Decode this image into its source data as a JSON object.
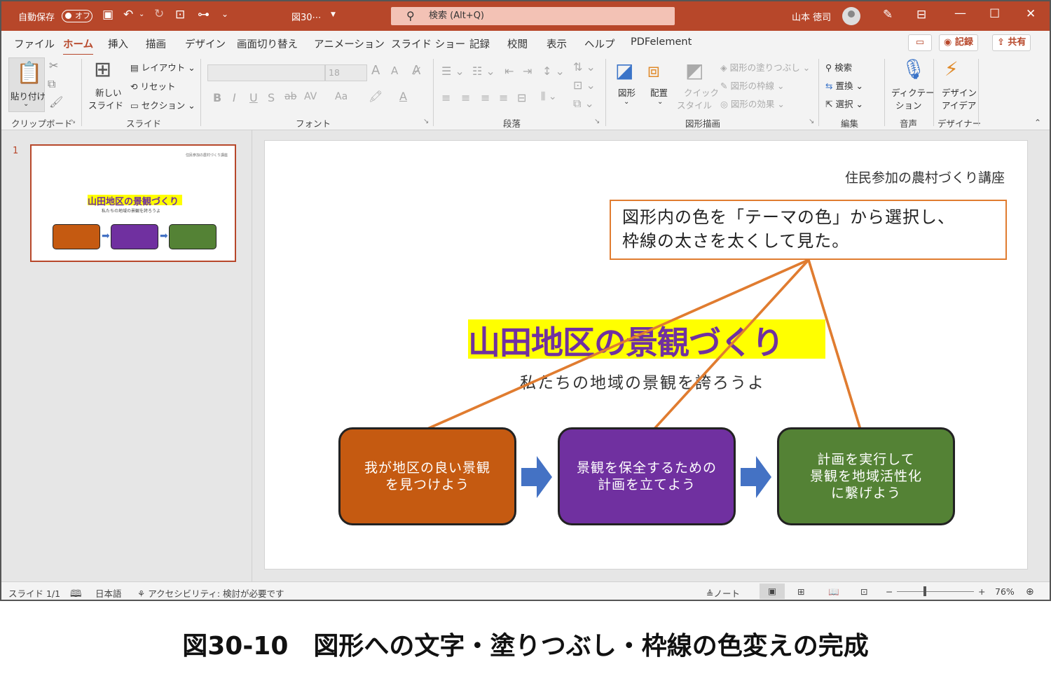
{
  "titlebar": {
    "autosave_label": "自動保存",
    "autosave_state": "オフ",
    "filename": "図30⋯",
    "search_placeholder": "検索 (Alt+Q)",
    "user_name": "山本 徳司"
  },
  "menu": {
    "tabs": [
      "ファイル",
      "ホーム",
      "挿入",
      "描画",
      "デザイン",
      "画面切り替え",
      "アニメーション",
      "スライド ショー",
      "記録",
      "校閲",
      "表示",
      "ヘルプ",
      "PDFelement"
    ],
    "active_tab": "ホーム",
    "record_button": "記録",
    "share_button": "共有"
  },
  "ribbon": {
    "clipboard": {
      "paste": "貼り付け",
      "group": "クリップボード"
    },
    "slides": {
      "new_slide_1": "新しい",
      "new_slide_2": "スライド",
      "layout": "レイアウト",
      "reset": "リセット",
      "section": "セクション",
      "group": "スライド"
    },
    "font": {
      "size": "18",
      "group": "フォント",
      "bold": "B",
      "italic": "I",
      "underline": "U",
      "shadow": "S",
      "strike": "ab",
      "spacing": "AV",
      "case": "Aa",
      "grow": "A",
      "shrink": "A"
    },
    "paragraph": {
      "group": "段落"
    },
    "drawing": {
      "shapes": "図形",
      "arrange": "配置",
      "quick1": "クイック",
      "quick2": "スタイル",
      "fill": "図形の塗りつぶし",
      "outline": "図形の枠線",
      "effects": "図形の効果",
      "group": "図形描画"
    },
    "editing": {
      "find": "検索",
      "replace": "置換",
      "select": "選択",
      "group": "編集"
    },
    "voice": {
      "dictate1": "ディクテー",
      "dictate2": "ション",
      "group": "音声"
    },
    "designer": {
      "idea1": "デザイン",
      "idea2": "アイデア",
      "group": "デザイナー"
    }
  },
  "thumbnail": {
    "number": "1"
  },
  "slide": {
    "header": "住民参加の農村づくり講座",
    "callout_line1": "図形内の色を「テーマの色」から選択し、",
    "callout_line2": "枠線の太さを太くして見た。",
    "title": "山田地区の景観づくり",
    "subtitle": "私たちの地域の景観を誇ろうよ",
    "boxes": [
      {
        "text": "我が地区の良い景観\nを見つけよう",
        "color": "#c55a11"
      },
      {
        "text": "景観を保全するための\n計画を立てよう",
        "color": "#7030a0"
      },
      {
        "text": "計画を実行して\n景観を地域活性化\nに繋げよう",
        "color": "#548235"
      }
    ],
    "arrow_color": "#4472c4",
    "callout_line_color": "#e07c30"
  },
  "statusbar": {
    "slide_count": "スライド 1/1",
    "language": "日本語",
    "accessibility": "アクセシビリティ: 検討が必要です",
    "notes": "ノート",
    "zoom": "76%"
  },
  "caption": "図30-10　図形への文字・塗りつぶし・枠線の色変えの完成"
}
